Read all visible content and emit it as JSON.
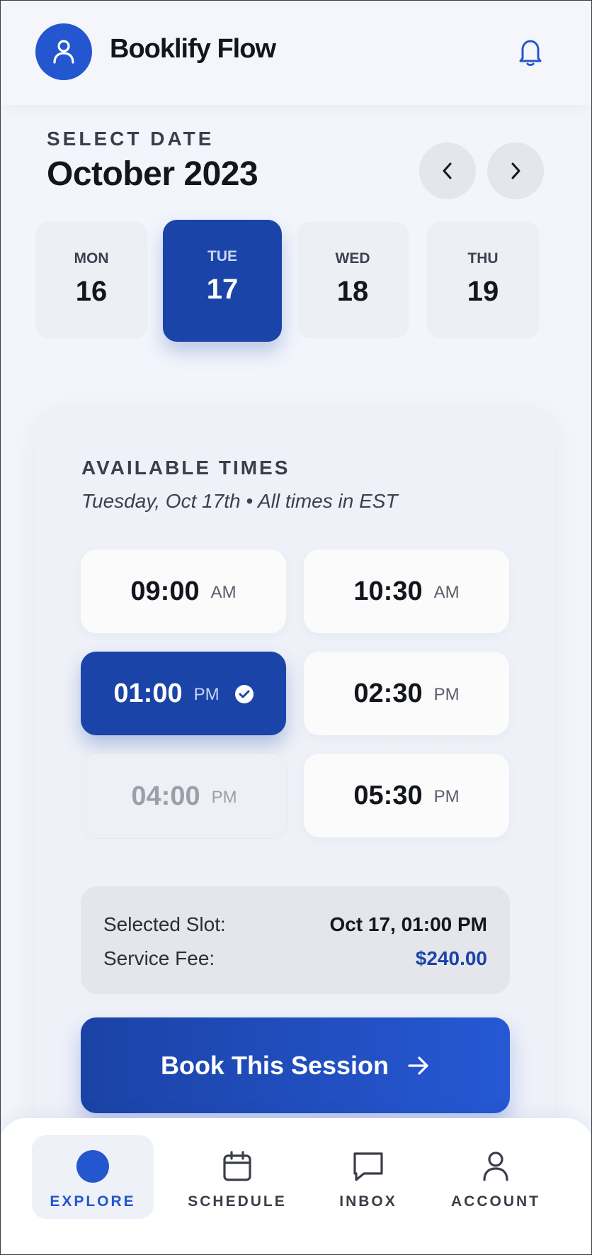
{
  "app": {
    "title": "Booklify Flow"
  },
  "date_picker": {
    "eyebrow": "SELECT DATE",
    "month": "October 2023",
    "days": [
      {
        "name": "MON",
        "num": "16",
        "selected": false
      },
      {
        "name": "TUE",
        "num": "17",
        "selected": true
      },
      {
        "name": "WED",
        "num": "18",
        "selected": false
      },
      {
        "name": "THU",
        "num": "19",
        "selected": false
      }
    ]
  },
  "times": {
    "title": "AVAILABLE TIMES",
    "subtitle": "Tuesday, Oct 17th • All times in EST",
    "slots": [
      {
        "time": "09:00",
        "period": "AM",
        "state": "available"
      },
      {
        "time": "10:30",
        "period": "AM",
        "state": "available"
      },
      {
        "time": "01:00",
        "period": "PM",
        "state": "selected"
      },
      {
        "time": "02:30",
        "period": "PM",
        "state": "available"
      },
      {
        "time": "04:00",
        "period": "PM",
        "state": "disabled"
      },
      {
        "time": "05:30",
        "period": "PM",
        "state": "available"
      }
    ]
  },
  "summary": {
    "selected_label": "Selected Slot:",
    "selected_value": "Oct 17, 01:00 PM",
    "fee_label": "Service Fee:",
    "fee_value": "$240.00"
  },
  "cta": {
    "label": "Book This Session"
  },
  "bottom_nav": {
    "tabs": [
      {
        "label": "EXPLORE",
        "icon": "dot-icon",
        "active": true
      },
      {
        "label": "SCHEDULE",
        "icon": "calendar-icon",
        "active": false
      },
      {
        "label": "INBOX",
        "icon": "chat-icon",
        "active": false
      },
      {
        "label": "ACCOUNT",
        "icon": "user-icon",
        "active": false
      }
    ]
  },
  "colors": {
    "accent": "#2356cf",
    "accent_dark": "#1b44a9",
    "background": "#f2f5fb",
    "text": "#14161d"
  }
}
